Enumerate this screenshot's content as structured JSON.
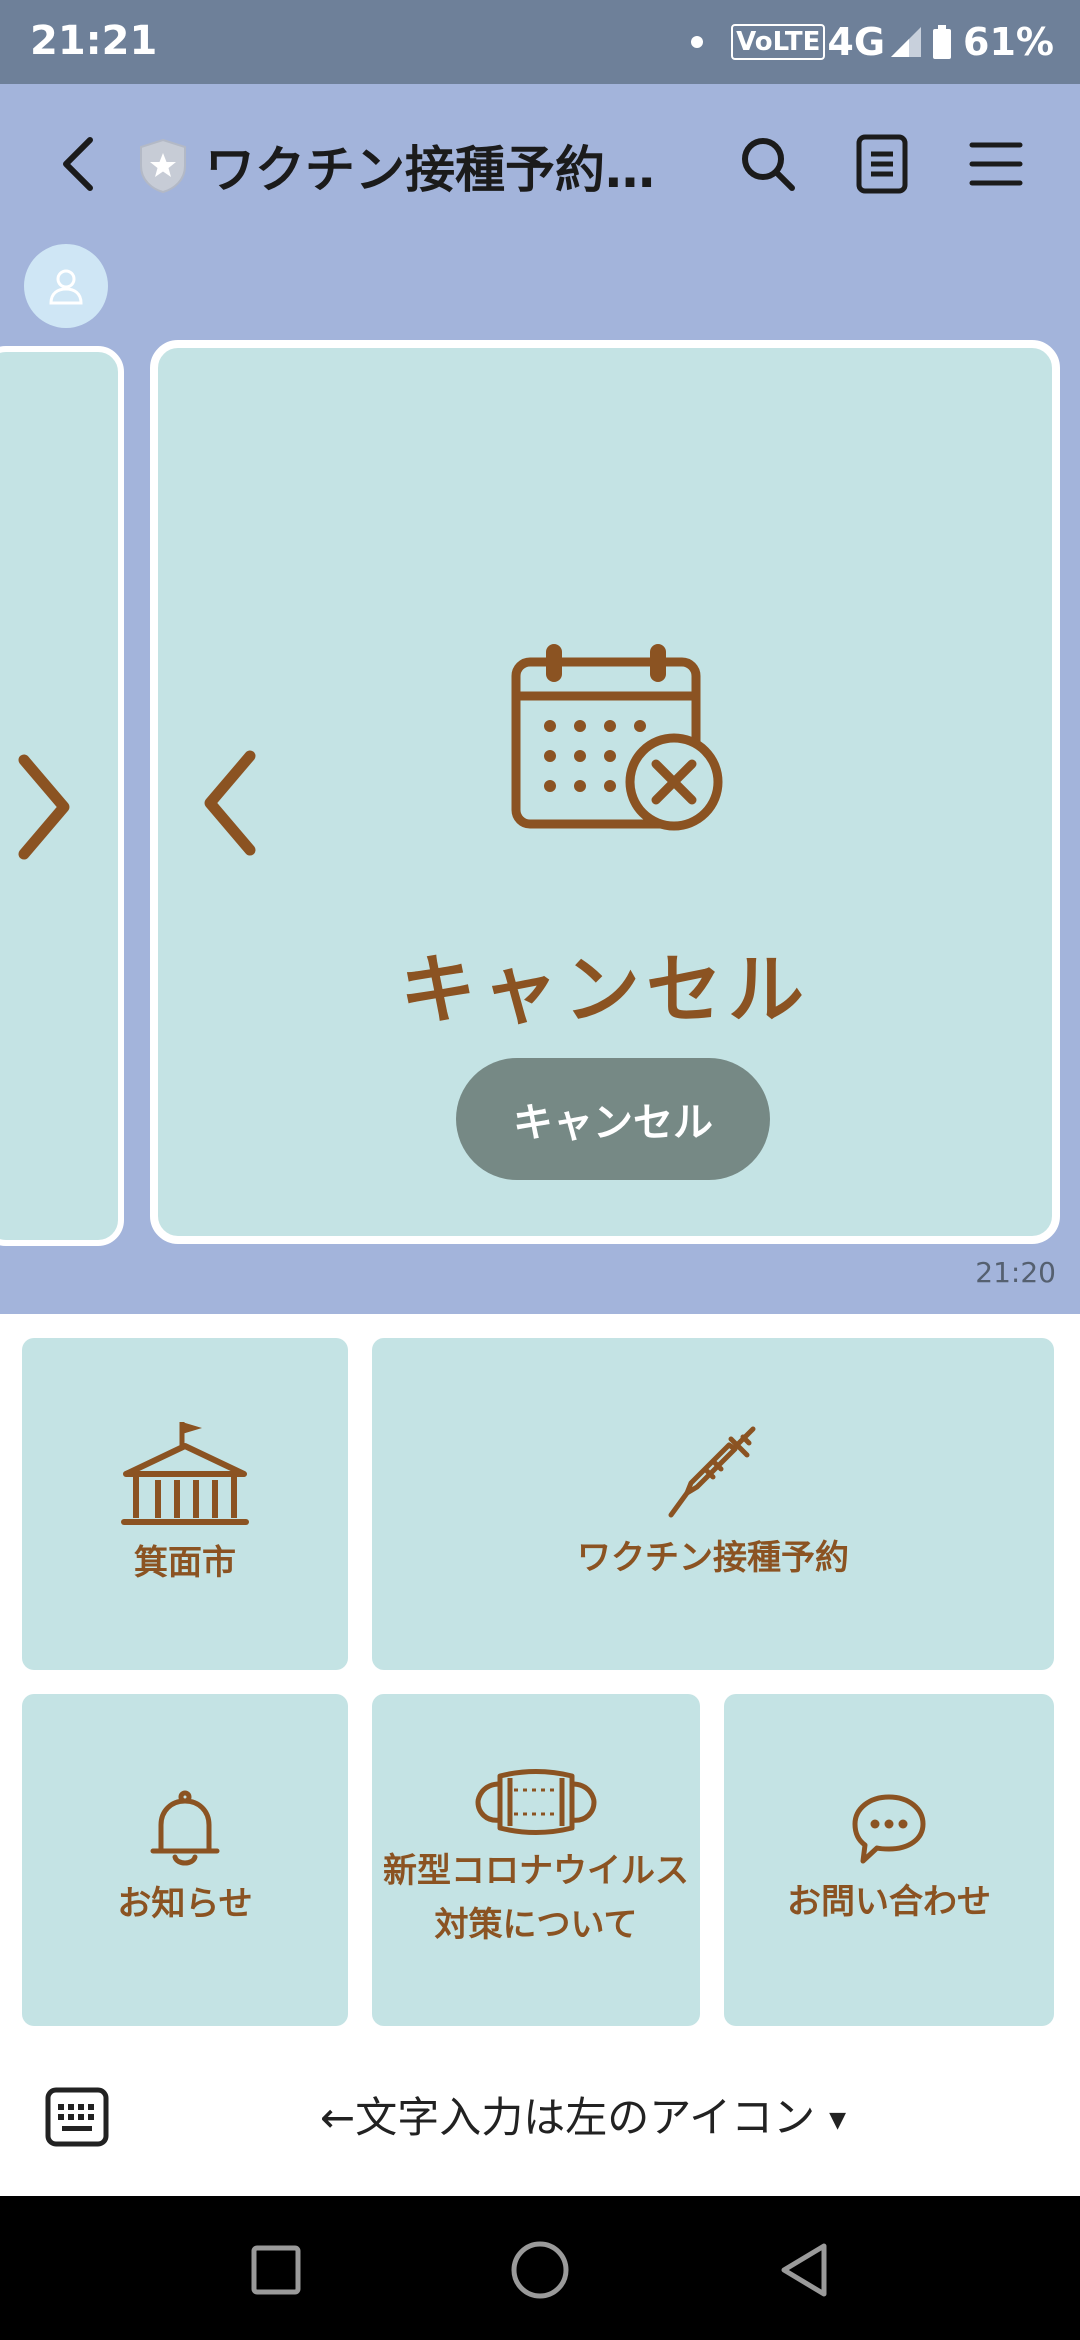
{
  "status_bar": {
    "time": "21:21",
    "volte": "VoLTE",
    "network": "4G",
    "battery": "61%"
  },
  "header": {
    "title": "ワクチン接種予約...",
    "icons": [
      "back-arrow-icon",
      "shield-badge-icon",
      "search-icon",
      "notes-icon",
      "menu-icon"
    ]
  },
  "message": {
    "card_title": "キャンセル",
    "button_label": "キャンセル",
    "timestamp": "21:20"
  },
  "rich_menu": {
    "tiles": [
      {
        "label": "箕面市",
        "icon": "city-hall-icon"
      },
      {
        "label": "ワクチン接種予約",
        "icon": "syringe-icon"
      },
      {
        "label": "お知らせ",
        "icon": "bell-icon"
      },
      {
        "label_line1": "新型コロナウイルス",
        "label_line2": "対策について",
        "icon": "mask-icon"
      },
      {
        "label": "お問い合わせ",
        "icon": "chat-bubble-icon"
      }
    ]
  },
  "input_bar": {
    "label": "←文字入力は左のアイコン",
    "toggle": "▼"
  },
  "colors": {
    "chat_background": "#a3b4db",
    "card": "#c4e3e4",
    "accent_brown": "#8b5322",
    "button_gray": "#768985"
  }
}
